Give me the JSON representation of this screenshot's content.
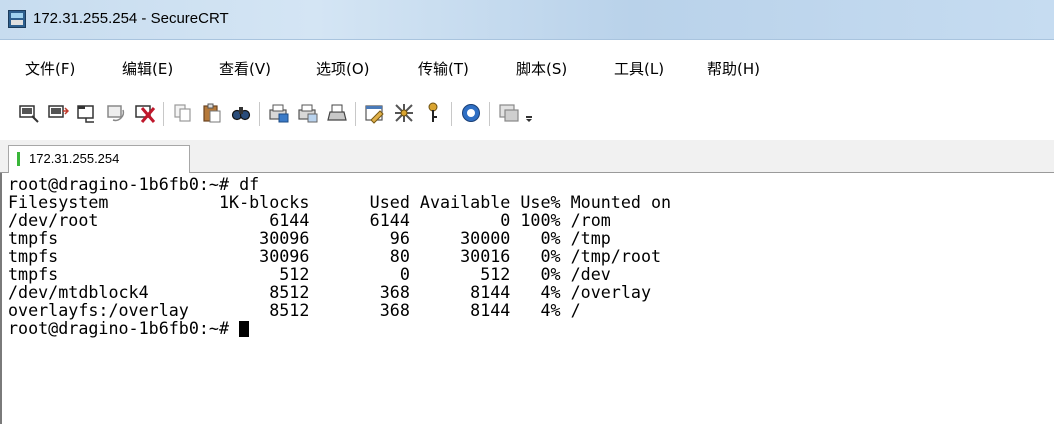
{
  "window": {
    "title": "172.31.255.254 - SecureCRT"
  },
  "menu": {
    "items": [
      {
        "label": "文件(F)"
      },
      {
        "label": "编辑(E)"
      },
      {
        "label": "查看(V)"
      },
      {
        "label": "选项(O)"
      },
      {
        "label": "传输(T)"
      },
      {
        "label": "脚本(S)"
      },
      {
        "label": "工具(L)"
      },
      {
        "label": "帮助(H)"
      }
    ]
  },
  "toolbar": {
    "icons": [
      "connect-icon",
      "quick-connect-icon",
      "connect-tab-icon",
      "reconnect-icon",
      "disconnect-icon",
      "copy-icon",
      "paste-icon",
      "find-icon",
      "print-setup-icon",
      "print-selection-icon",
      "print-icon",
      "session-options-icon",
      "global-options-icon",
      "keymap-icon",
      "help-icon",
      "sftp-icon",
      "toolbar-overflow-icon"
    ]
  },
  "tabs": [
    {
      "label": "172.31.255.254",
      "status": "connected"
    }
  ],
  "terminal": {
    "lines": [
      "root@dragino-1b6fb0:~# df",
      "Filesystem           1K-blocks      Used Available Use% Mounted on",
      "/dev/root                 6144      6144         0 100% /rom",
      "tmpfs                    30096        96     30000   0% /tmp",
      "tmpfs                    30096        80     30016   0% /tmp/root",
      "tmpfs                      512         0       512   0% /dev",
      "/dev/mtdblock4            8512       368      8144   4% /overlay",
      "overlayfs:/overlay        8512       368      8144   4% /"
    ],
    "prompt": "root@dragino-1b6fb0:~# "
  }
}
